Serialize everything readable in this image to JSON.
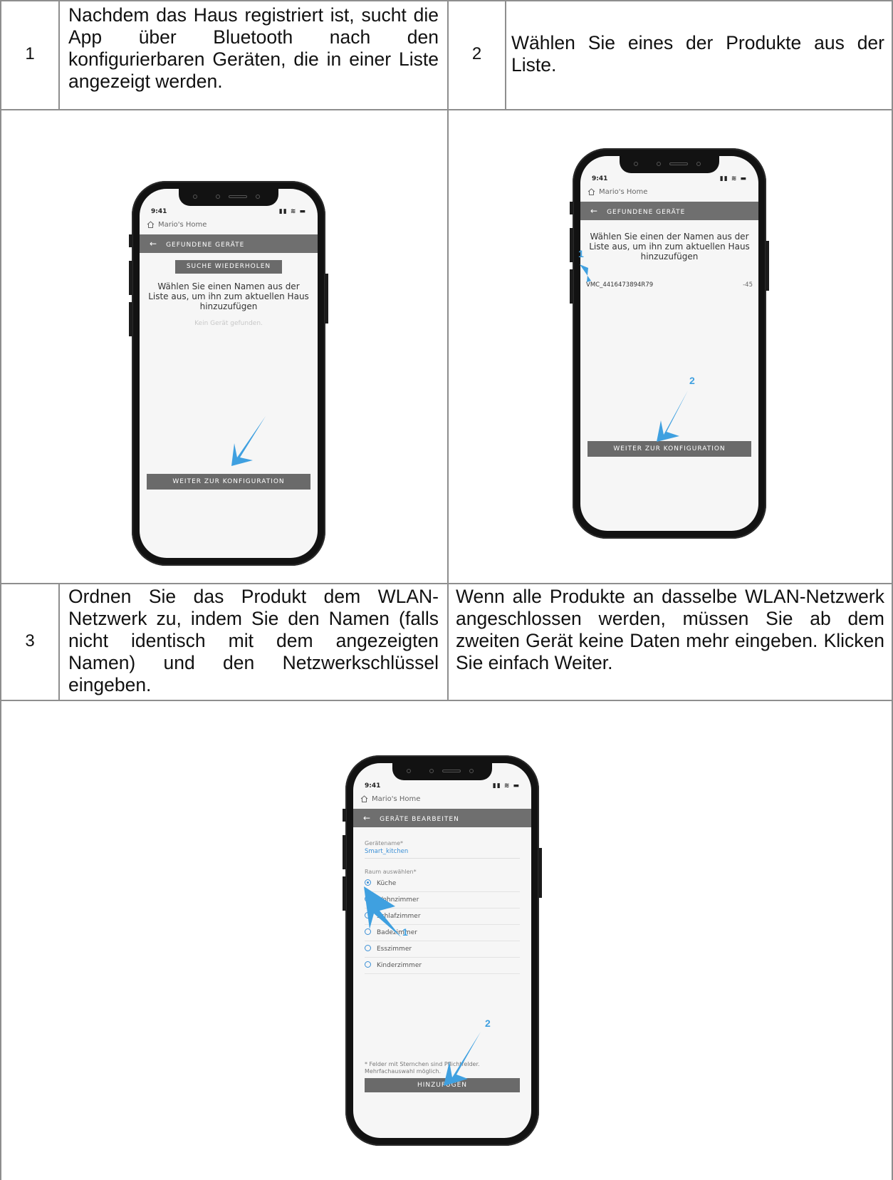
{
  "row1": {
    "left_number": "1",
    "left_text": "Nachdem das Haus registriert ist, sucht die App über Bluetooth nach den konfigurierbaren Geräten, die in einer Liste angezeigt werden.",
    "right_number": "2",
    "right_text": "Wählen Sie eines der Produkte aus der Liste."
  },
  "row3": {
    "left_number": "3",
    "left_text": "Ordnen Sie das Produkt dem WLAN-Netzwerk zu, indem Sie den Namen (falls nicht identisch mit dem angezeigten Namen) und den Netzwerkschlüssel eingeben.",
    "right_text": "Wenn alle Produkte an dasselbe WLAN-Netzwerk angeschlossen werden, müssen Sie ab dem zweiten Gerät keine Daten mehr eingeben. Klicken Sie einfach Weiter."
  },
  "phone1": {
    "time": "9:41",
    "home": "Mario's Home",
    "header": "GEFUNDENE GERÄTE",
    "search_button": "SUCHE WIEDERHOLEN",
    "instruction": "Wählen Sie einen Namen aus der Liste aus, um ihn zum aktuellen Haus hinzuzufügen",
    "empty": "Kein Gerät gefunden.",
    "next_button": "WEITER ZUR KONFIGURATION"
  },
  "phone2": {
    "time": "9:41",
    "home": "Mario's Home",
    "header": "GEFUNDENE GERÄTE",
    "instruction": "Wählen Sie einen der Namen aus der Liste aus, um ihn zum aktuellen Haus hinzuzufügen",
    "device_name": "VMC_4416473894R79",
    "device_rssi": "-45",
    "next_button": "WEITER ZUR KONFIGURATION",
    "marker1": "1",
    "marker2": "2"
  },
  "phone3": {
    "time": "9:41",
    "home": "Mario's Home",
    "header": "GERÄTE BEARBEITEN",
    "device_label": "Gerätename*",
    "device_value": "Smart_kitchen",
    "room_label": "Raum auswählen*",
    "rooms": [
      "Küche",
      "Wohnzimmer",
      "Schlafzimmer",
      "Badezimmer",
      "Esszimmer",
      "Kinderzimmer"
    ],
    "note": "* Felder mit Sternchen sind Pflichtfelder. Mehrfachauswahl möglich.",
    "add_button": "HINZUFÜGEN",
    "marker1": "1",
    "marker2": "2"
  },
  "colors": {
    "accent": "#3a8fd6",
    "header": "#6f6f6f",
    "arrow": "#3fa0e0",
    "grid": "#8e8e8e"
  }
}
